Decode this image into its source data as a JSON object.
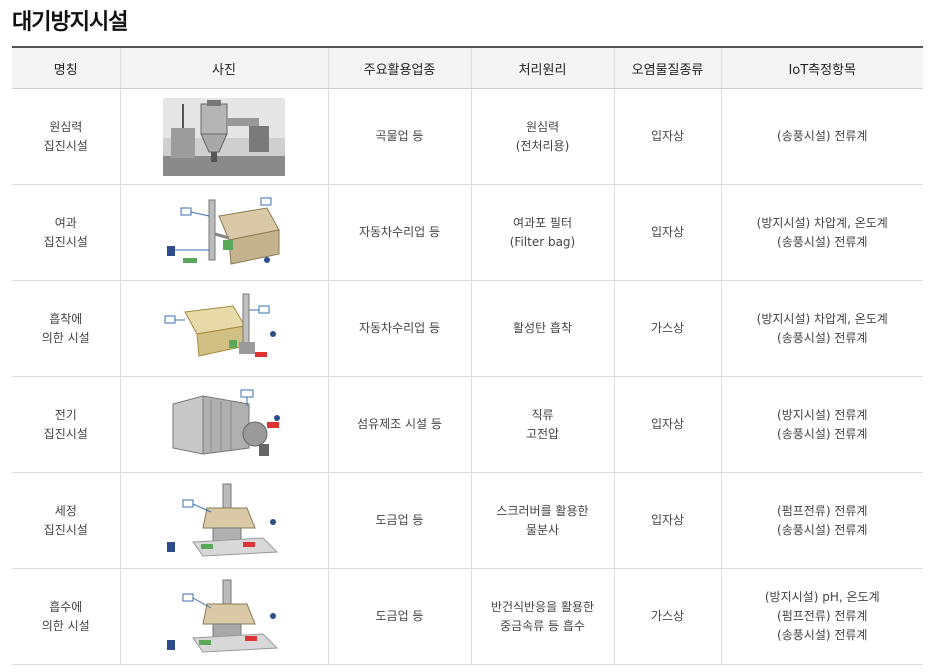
{
  "title": "대기방지시설",
  "headers": [
    "명칭",
    "사진",
    "주요활용업종",
    "처리원리",
    "오염물질종류",
    "IoT측정항목"
  ],
  "rows": [
    {
      "name": [
        "원심력",
        "집진시설"
      ],
      "photo": "centrifugal-collector-photo",
      "industry": [
        "곡물업 등"
      ],
      "principle": [
        "원심력",
        "(전처리용)"
      ],
      "pollutant": [
        "입자상"
      ],
      "iot": [
        "(송풍시설) 전류계"
      ]
    },
    {
      "name": [
        "여과",
        "집진시설"
      ],
      "photo": "filter-collector-diagram",
      "industry": [
        "자동차수리업 등"
      ],
      "principle": [
        "여과포 필터",
        "(Filter bag)"
      ],
      "pollutant": [
        "입자상"
      ],
      "iot": [
        "(방지시설) 차압계, 온도계",
        "(송풍시설) 전류계"
      ]
    },
    {
      "name": [
        "흡착에",
        "의한 시설"
      ],
      "photo": "adsorption-facility-diagram",
      "industry": [
        "자동차수리업 등"
      ],
      "principle": [
        "활성탄 흡착"
      ],
      "pollutant": [
        "가스상"
      ],
      "iot": [
        "(방지시설) 차압계, 온도계",
        "(송풍시설) 전류계"
      ]
    },
    {
      "name": [
        "전기",
        "집진시설"
      ],
      "photo": "electrostatic-precipitator-diagram",
      "industry": [
        "섬유제조 시설 등"
      ],
      "principle": [
        "직류",
        "고전압"
      ],
      "pollutant": [
        "입자상"
      ],
      "iot": [
        "(방지시설) 전류계",
        "(송풍시설) 전류계"
      ]
    },
    {
      "name": [
        "세정",
        "집진시설"
      ],
      "photo": "scrubber-collector-diagram",
      "industry": [
        "도금업 등"
      ],
      "principle": [
        "스크러버를 활용한",
        "물분사"
      ],
      "pollutant": [
        "입자상"
      ],
      "iot": [
        "(펌프전류) 전류계",
        "(송풍시설) 전류계"
      ]
    },
    {
      "name": [
        "흡수에",
        "의한 시설"
      ],
      "photo": "absorption-facility-diagram",
      "industry": [
        "도금업 등"
      ],
      "principle": [
        "반건식반응을 활용한",
        "중금속류 등 흡수"
      ],
      "pollutant": [
        "가스상"
      ],
      "iot": [
        "(방지시설) pH, 온도계",
        "(펌프전류) 전류계",
        "(송풍시설) 전류계"
      ]
    }
  ]
}
